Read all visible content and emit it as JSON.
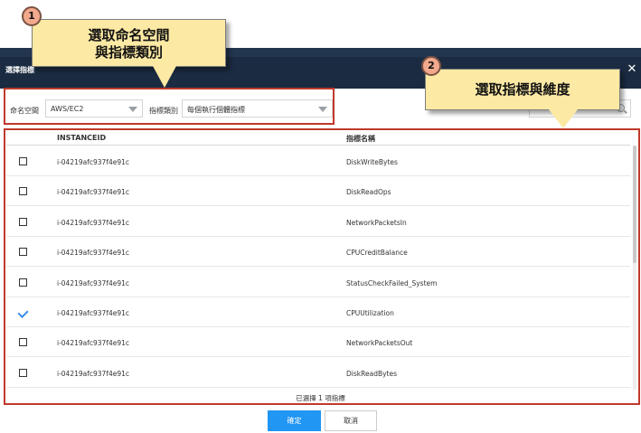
{
  "dialog": {
    "title": "選擇指標",
    "close_glyph": "✕"
  },
  "filters": {
    "namespace_label": "命名空間",
    "namespace_value": "AWS/EC2",
    "metric_type_label": "指標類別",
    "metric_type_value": "每個執行個體指標"
  },
  "table": {
    "headers": {
      "instance": "INSTANCEID",
      "metric": "指標名稱"
    },
    "rows": [
      {
        "instance": "i-04219afc937f4e91c",
        "metric": "DiskWriteBytes",
        "checked": false
      },
      {
        "instance": "i-04219afc937f4e91c",
        "metric": "DiskReadOps",
        "checked": false
      },
      {
        "instance": "i-04219afc937f4e91c",
        "metric": "NetworkPacketsIn",
        "checked": false
      },
      {
        "instance": "i-04219afc937f4e91c",
        "metric": "CPUCreditBalance",
        "checked": false
      },
      {
        "instance": "i-04219afc937f4e91c",
        "metric": "StatusCheckFailed_System",
        "checked": false
      },
      {
        "instance": "i-04219afc937f4e91c",
        "metric": "CPUUtilization",
        "checked": true
      },
      {
        "instance": "i-04219afc937f4e91c",
        "metric": "NetworkPacketsOut",
        "checked": false
      },
      {
        "instance": "i-04219afc937f4e91c",
        "metric": "DiskReadBytes",
        "checked": false
      }
    ]
  },
  "selected_count_text": "已選擇 1 項指標",
  "buttons": {
    "ok": "確定",
    "cancel": "取消"
  },
  "callouts": [
    {
      "badge": "1",
      "line1": "選取命名空間",
      "line2": "與指標類別"
    },
    {
      "badge": "2",
      "line1": "選取指標與維度"
    }
  ],
  "colors": {
    "titlebar": "#1b2b41",
    "accent": "#2196f3",
    "callout": "#fce9a4",
    "highlight_border": "#c0392b",
    "checkbox_check": "#3a8ee6"
  },
  "icons": {
    "close": "close-icon",
    "search": "search-icon",
    "dropdown": "chevron-down-icon"
  }
}
